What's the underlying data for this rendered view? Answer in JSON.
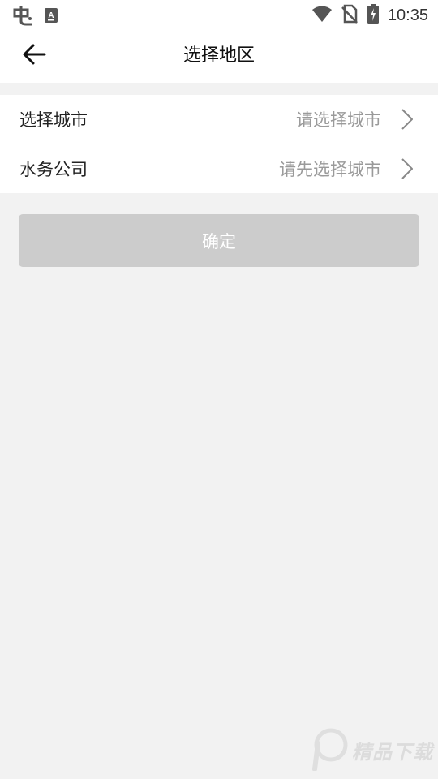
{
  "status_bar": {
    "time": "10:35",
    "left_icons": [
      "app-notification-icon",
      "keyboard-a-icon"
    ],
    "right_icons": [
      "wifi-icon",
      "no-sim-icon",
      "battery-charging-icon"
    ]
  },
  "app_bar": {
    "title": "选择地区",
    "back_icon": "arrow-left-icon"
  },
  "form": {
    "rows": [
      {
        "label": "选择城市",
        "value": "请选择城市"
      },
      {
        "label": "水务公司",
        "value": "请先选择城市"
      }
    ]
  },
  "confirm_button": {
    "label": "确定"
  },
  "watermark": {
    "text": "精品下载"
  },
  "colors": {
    "background": "#f2f2f2",
    "surface": "#ffffff",
    "button_disabled": "#cccccc",
    "placeholder": "#9a9a9a",
    "divider": "#dedede"
  }
}
